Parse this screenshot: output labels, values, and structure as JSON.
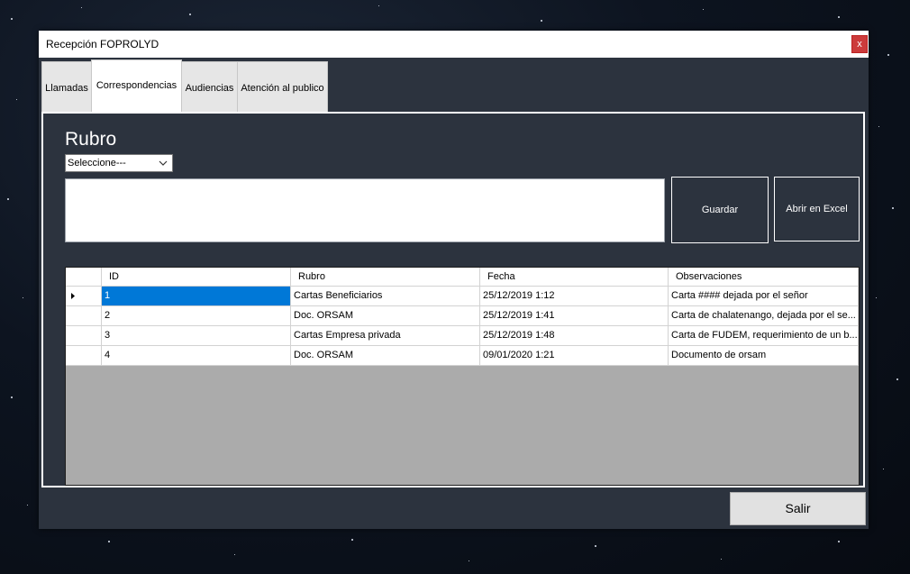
{
  "window": {
    "title": "Recepción FOPROLYD",
    "close_label": "x"
  },
  "tabs": [
    {
      "label": "Llamadas",
      "active": false
    },
    {
      "label": "Correspondencias",
      "active": true
    },
    {
      "label": "Audiencias",
      "active": false
    },
    {
      "label": "Atención al publico",
      "active": false
    }
  ],
  "form": {
    "heading": "Rubro",
    "select_value": "Seleccione---",
    "observations_value": "",
    "save_label": "Guardar",
    "excel_label": "Abrir en Excel"
  },
  "table": {
    "columns": [
      "ID",
      "Rubro",
      "Fecha",
      "Observaciones"
    ],
    "rows": [
      {
        "id": "1",
        "rubro": "Cartas Beneficiarios",
        "fecha": "25/12/2019 1:12",
        "obs": "Carta #### dejada por el señor",
        "selected": true
      },
      {
        "id": "2",
        "rubro": "Doc. ORSAM",
        "fecha": "25/12/2019 1:41",
        "obs": "Carta de chalatenango, dejada por el se...",
        "selected": false
      },
      {
        "id": "3",
        "rubro": "Cartas Empresa privada",
        "fecha": "25/12/2019 1:48",
        "obs": "Carta de FUDEM, requerimiento de un b...",
        "selected": false
      },
      {
        "id": "4",
        "rubro": "Doc. ORSAM",
        "fecha": "09/01/2020 1:21",
        "obs": "Documento de orsam",
        "selected": false
      }
    ]
  },
  "footer": {
    "exit_label": "Salir"
  },
  "colors": {
    "panel_bg": "#2c333e",
    "selection": "#0078d7",
    "close_button": "#cc3b3b",
    "grid_empty": "#ababab"
  }
}
